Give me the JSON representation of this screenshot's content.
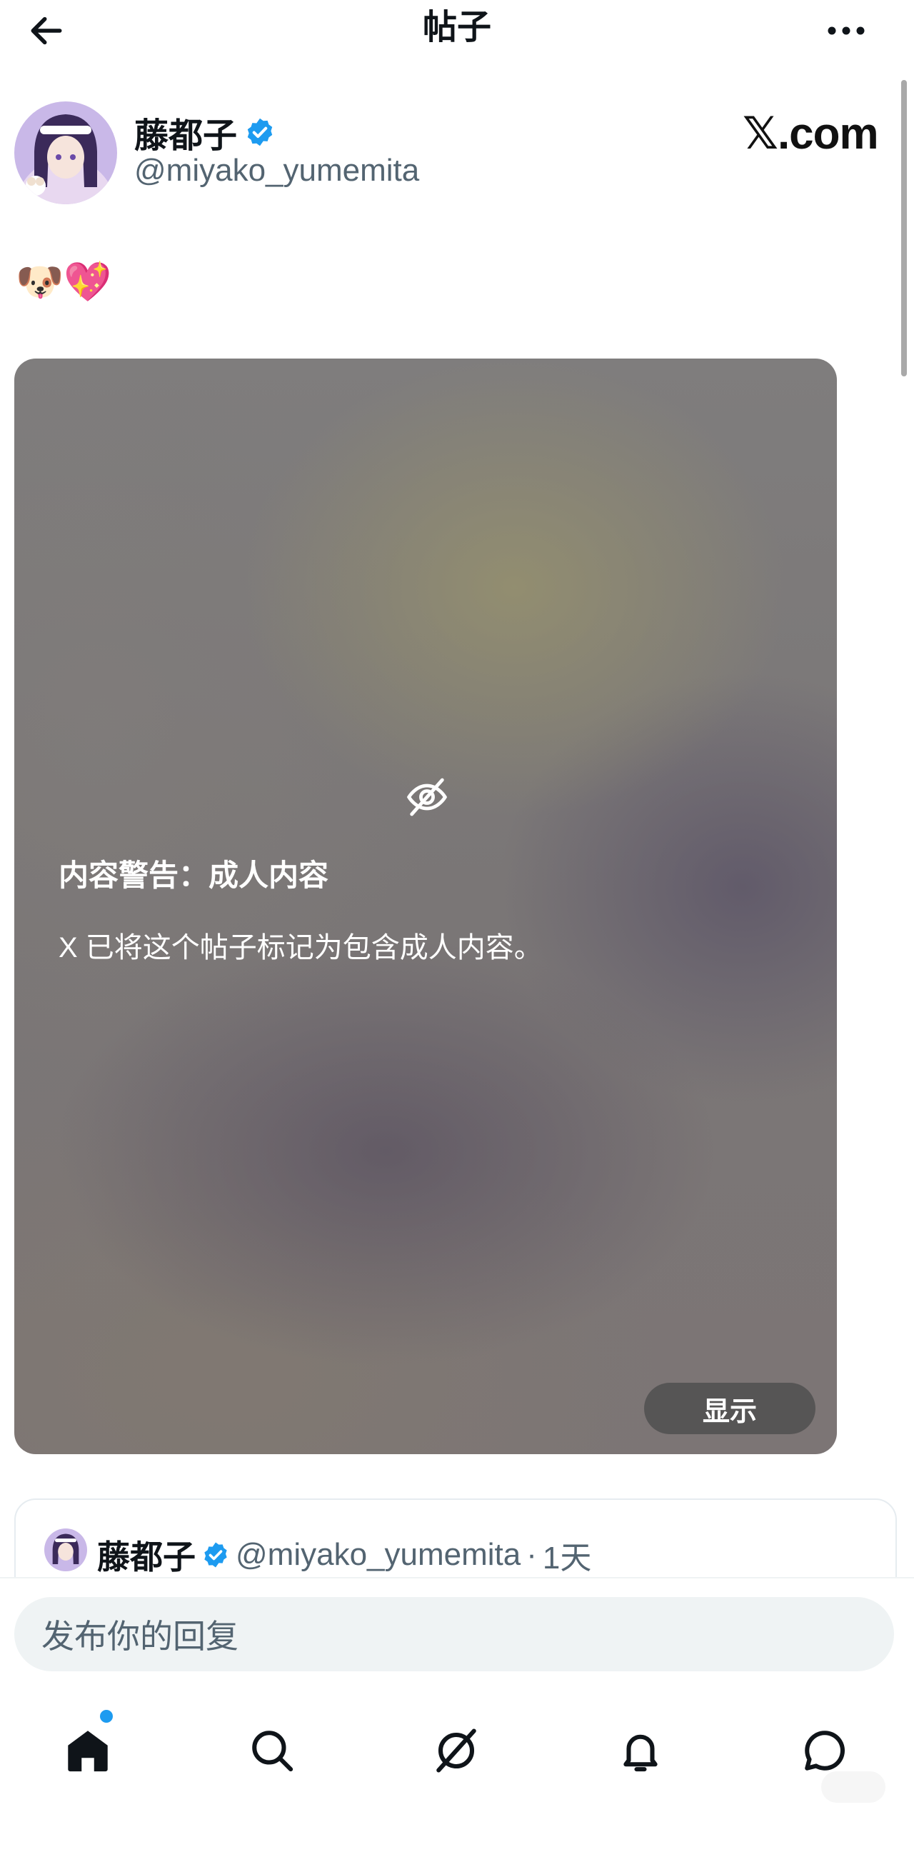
{
  "header": {
    "title": "帖子",
    "back_icon": "arrow-left-icon",
    "more_icon": "more-horizontal-icon"
  },
  "author": {
    "name": "藤都子",
    "handle": "@miyako_yumemita",
    "verified_icon": "verified-badge-icon"
  },
  "watermark": "𝕏.com",
  "post": {
    "text": "🐶💖"
  },
  "media": {
    "warning_icon": "eye-slash-icon",
    "warning_title": "内容警告：成人内容",
    "warning_text": "X 已将这个帖子标记为包含成人内容。",
    "show_label": "显示"
  },
  "quote": {
    "name": "藤都子",
    "handle": "@miyako_yumemita",
    "separator": "·",
    "time": "1天"
  },
  "reply": {
    "placeholder": "发布你的回复"
  },
  "nav": {
    "items": [
      "home-icon",
      "search-icon",
      "grok-icon",
      "notifications-bell-icon",
      "messages-icon"
    ]
  },
  "colors": {
    "accent": "#1d9bf0",
    "text": "#0f1419",
    "secondary": "#536471"
  }
}
